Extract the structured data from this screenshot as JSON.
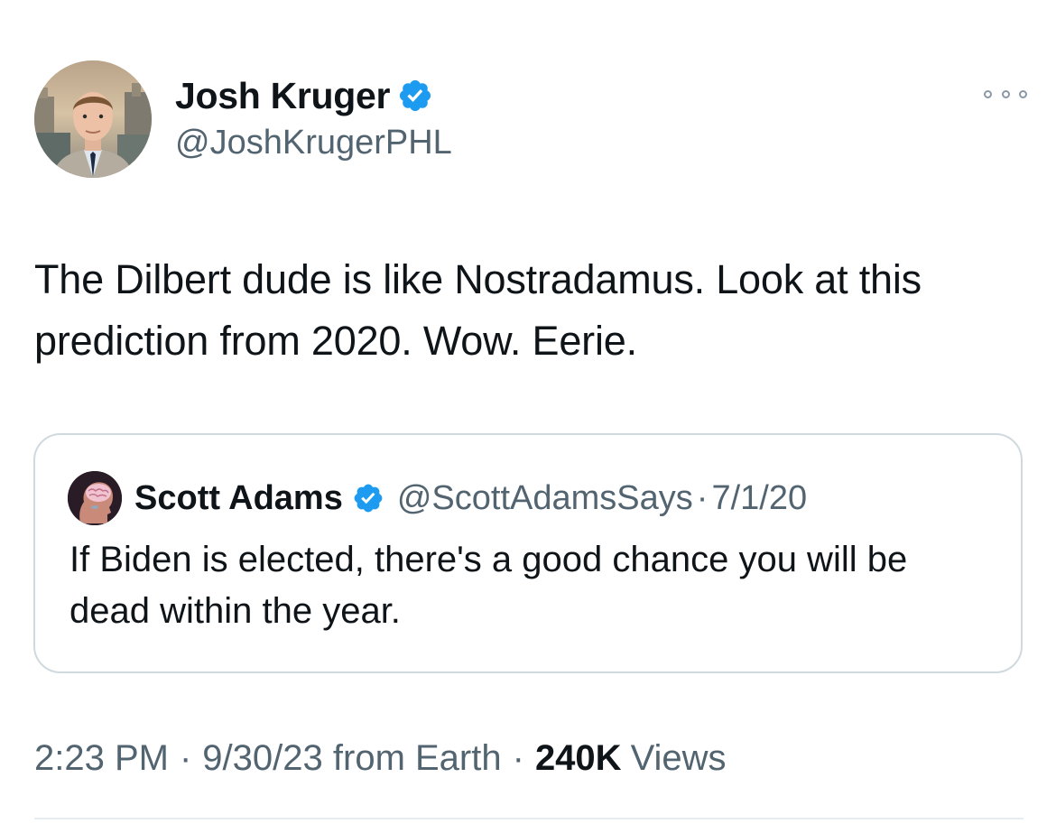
{
  "author": {
    "display_name": "Josh Kruger",
    "handle": "@JoshKrugerPHL",
    "verified": true
  },
  "more_icon": "more-horizontal-icon",
  "tweet": {
    "text": "The Dilbert dude is like Nostradamus. Look at this prediction from 2020. Wow. Eerie."
  },
  "quoted_tweet": {
    "display_name": "Scott Adams",
    "handle": "@ScottAdamsSays",
    "separator": "·",
    "date": "7/1/20",
    "text": "If Biden is elected, there's a good chance you will be dead within the year."
  },
  "meta": {
    "time": "2:23 PM",
    "date": "9/30/23",
    "source": "from Earth",
    "separator": "·",
    "views_count": "240K",
    "views_label": "Views"
  },
  "colors": {
    "verified_blue": "#1d9bf0",
    "text_primary": "#0f1419",
    "text_secondary": "#536471",
    "border": "#cfd9de"
  }
}
